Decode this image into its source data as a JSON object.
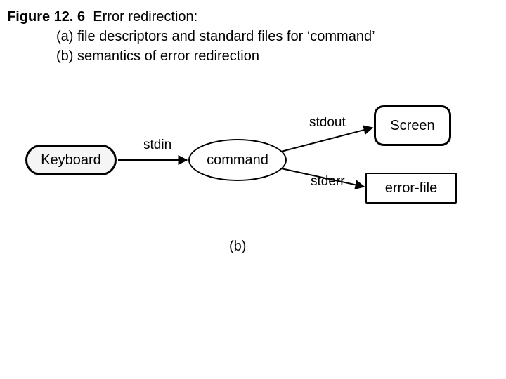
{
  "figure": {
    "label": "Figure 12. 6",
    "title": "Error redirection:",
    "line_a": "(a) file descriptors and standard files for ‘command’",
    "line_b": "(b) semantics of error redirection"
  },
  "nodes": {
    "keyboard": "Keyboard",
    "command": "command",
    "screen": "Screen",
    "errorfile": "error-file"
  },
  "streams": {
    "stdin": "stdin",
    "stdout": "stdout",
    "stderr": "stderr"
  },
  "panel_label": "(b)",
  "chart_data": {
    "type": "diagram",
    "title": "Error redirection — semantics (panel b)",
    "nodes": [
      {
        "id": "keyboard",
        "label": "Keyboard",
        "shape": "rounded-rect"
      },
      {
        "id": "command",
        "label": "command",
        "shape": "ellipse"
      },
      {
        "id": "screen",
        "label": "Screen",
        "shape": "rounded-rect"
      },
      {
        "id": "errorfile",
        "label": "error-file",
        "shape": "rect"
      }
    ],
    "edges": [
      {
        "from": "keyboard",
        "to": "command",
        "label": "stdin"
      },
      {
        "from": "command",
        "to": "screen",
        "label": "stdout"
      },
      {
        "from": "command",
        "to": "errorfile",
        "label": "stderr"
      }
    ]
  }
}
